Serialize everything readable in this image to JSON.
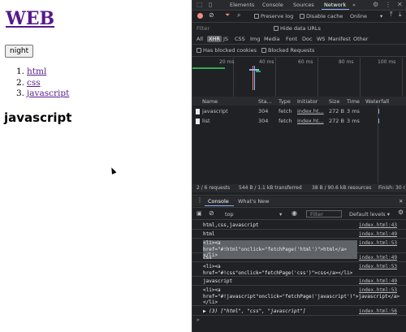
{
  "page": {
    "title": "WEB",
    "night_button": "night",
    "list": [
      {
        "num": "1.",
        "label": "html"
      },
      {
        "num": "2.",
        "label": "css"
      },
      {
        "num": "3.",
        "label": "javascript"
      }
    ],
    "heading": "javascript"
  },
  "devtools": {
    "tabs": [
      "Elements",
      "Console",
      "Sources",
      "Network"
    ],
    "active_tab": "Network",
    "more_tabs": "»",
    "network": {
      "preserve_log": "Preserve log",
      "disable_cache": "Disable cache",
      "throttle": "Online",
      "filter_placeholder": "Filter",
      "hide_data_urls": "Hide data URLs",
      "types": [
        "All",
        "XHR",
        "JS",
        "CSS",
        "Img",
        "Media",
        "Font",
        "Doc",
        "WS",
        "Manifest",
        "Other"
      ],
      "selected_type": "XHR",
      "has_blocked_cookies": "Has blocked cookies",
      "blocked_requests": "Blocked Requests",
      "timeline_ticks": [
        "20 ms",
        "40 ms",
        "60 ms",
        "80 ms",
        "100 ms"
      ],
      "columns": [
        "Name",
        "Sta...",
        "Type",
        "Initiator",
        "Size",
        "Time",
        "Waterfall"
      ],
      "requests": [
        {
          "name": "javascript",
          "status": "304",
          "type": "fetch",
          "initiator": "index.ht...",
          "size": "272 B",
          "time": "3 ms"
        },
        {
          "name": "list",
          "status": "304",
          "type": "fetch",
          "initiator": "index.ht...",
          "size": "272 B",
          "time": "3 ms"
        }
      ],
      "status": {
        "requests": "2 / 6 requests",
        "transferred": "544 B / 1.1 kB transferred",
        "resources": "38 B / 90.6 kB resources",
        "finish": "Finish: 30 r"
      }
    },
    "drawer": {
      "tabs": [
        "Console",
        "What's New"
      ],
      "active_tab": "Console",
      "context": "top",
      "filter_placeholder": "Filter",
      "levels": "Default levels ▾"
    },
    "console_logs": [
      {
        "text": "html,css,javascript",
        "src": "index.html:43"
      },
      {
        "text": "html",
        "src": "index.html:49"
      },
      {
        "text": "<li><a href=\"#!html\"onclick=\"fetchPage('html')\">html</a></li>",
        "src": "index.html:53",
        "highlight": true
      },
      {
        "text": "css",
        "src": "index.html:49"
      },
      {
        "text": "<li><a href=\"#!css\"onclick=\"fetchPage('css')\">css</a></li>",
        "src": "index.html:53"
      },
      {
        "text": "javascript",
        "src": "index.html:49"
      },
      {
        "text": "<li><a href=\"#!javascript\"onclick=\"fetchPage('javascript')\">javascript</a></li>",
        "src": "index.html:53"
      },
      {
        "text": "▶ (3) [\"html\", \"css\", \"javascript\"]",
        "src": "index.html:56",
        "array": true
      }
    ],
    "prompt": ">"
  },
  "colors": {
    "link_visited": "#551a8b",
    "devtools_bg": "#202124",
    "accent": "#8ab4f8",
    "record": "#f28b82"
  }
}
